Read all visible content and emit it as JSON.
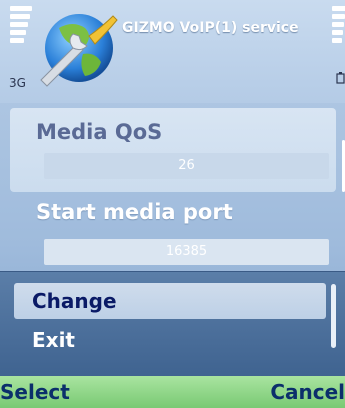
{
  "status": {
    "network": "3G",
    "signal_level": 5,
    "battery_level": 5
  },
  "app": {
    "title": "GIZMO VoIP(1) service",
    "icon": "globe-wrench-icon"
  },
  "settings": [
    {
      "label": "Media QoS",
      "value": "26",
      "highlighted": true
    },
    {
      "label": "Start media port",
      "value": "16385",
      "highlighted": false
    }
  ],
  "options_menu": {
    "items": [
      {
        "label": "Change",
        "selected": true
      },
      {
        "label": "Exit",
        "selected": false
      }
    ]
  },
  "softkeys": {
    "left": "Select",
    "right": "Cancel"
  },
  "colors": {
    "softkey_bar": "#79c973",
    "menu_background": "#4b6f9c",
    "selected_text": "#0a1a66"
  }
}
